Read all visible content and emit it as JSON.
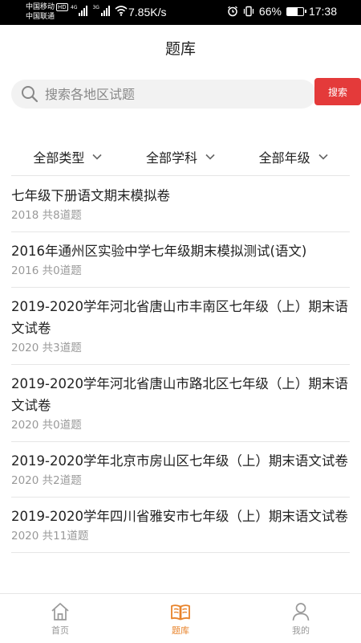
{
  "status_bar": {
    "carrier1": "中国移动",
    "carrier1_badge": "HD",
    "carrier2": "中国联通",
    "net1": "4G",
    "net2": "3G",
    "speed": "7.85K/s",
    "battery": "66%",
    "time": "17:38",
    "battery_level": 0.66
  },
  "header": {
    "title": "题库"
  },
  "search": {
    "placeholder": "搜索各地区试题",
    "button": "搜索"
  },
  "filters": [
    {
      "label": "全部类型"
    },
    {
      "label": "全部学科"
    },
    {
      "label": "全部年级"
    }
  ],
  "papers": [
    {
      "title": "七年级下册语文期末模拟卷",
      "meta": "2018 共8道题"
    },
    {
      "title": "2016年通州区实验中学七年级期末模拟测试(语文)",
      "meta": "2016 共0道题"
    },
    {
      "title": "2019-2020学年河北省唐山市丰南区七年级（上）期末语文试卷",
      "meta": "2020 共3道题"
    },
    {
      "title": "2019-2020学年河北省唐山市路北区七年级（上）期末语文试卷",
      "meta": "2020 共0道题"
    },
    {
      "title": "2019-2020学年北京市房山区七年级（上）期末语文试卷",
      "meta": "2020 共2道题"
    },
    {
      "title": "2019-2020学年四川省雅安市七年级（上）期末语文试卷",
      "meta": "2020 共11道题"
    }
  ],
  "tabbar": [
    {
      "label": "首页",
      "icon": "home-icon"
    },
    {
      "label": "题库",
      "icon": "book-icon",
      "active": true
    },
    {
      "label": "我的",
      "icon": "user-icon"
    }
  ],
  "colors": {
    "accent": "#e8832a",
    "search_button": "#e43a3a",
    "muted": "#999999"
  }
}
